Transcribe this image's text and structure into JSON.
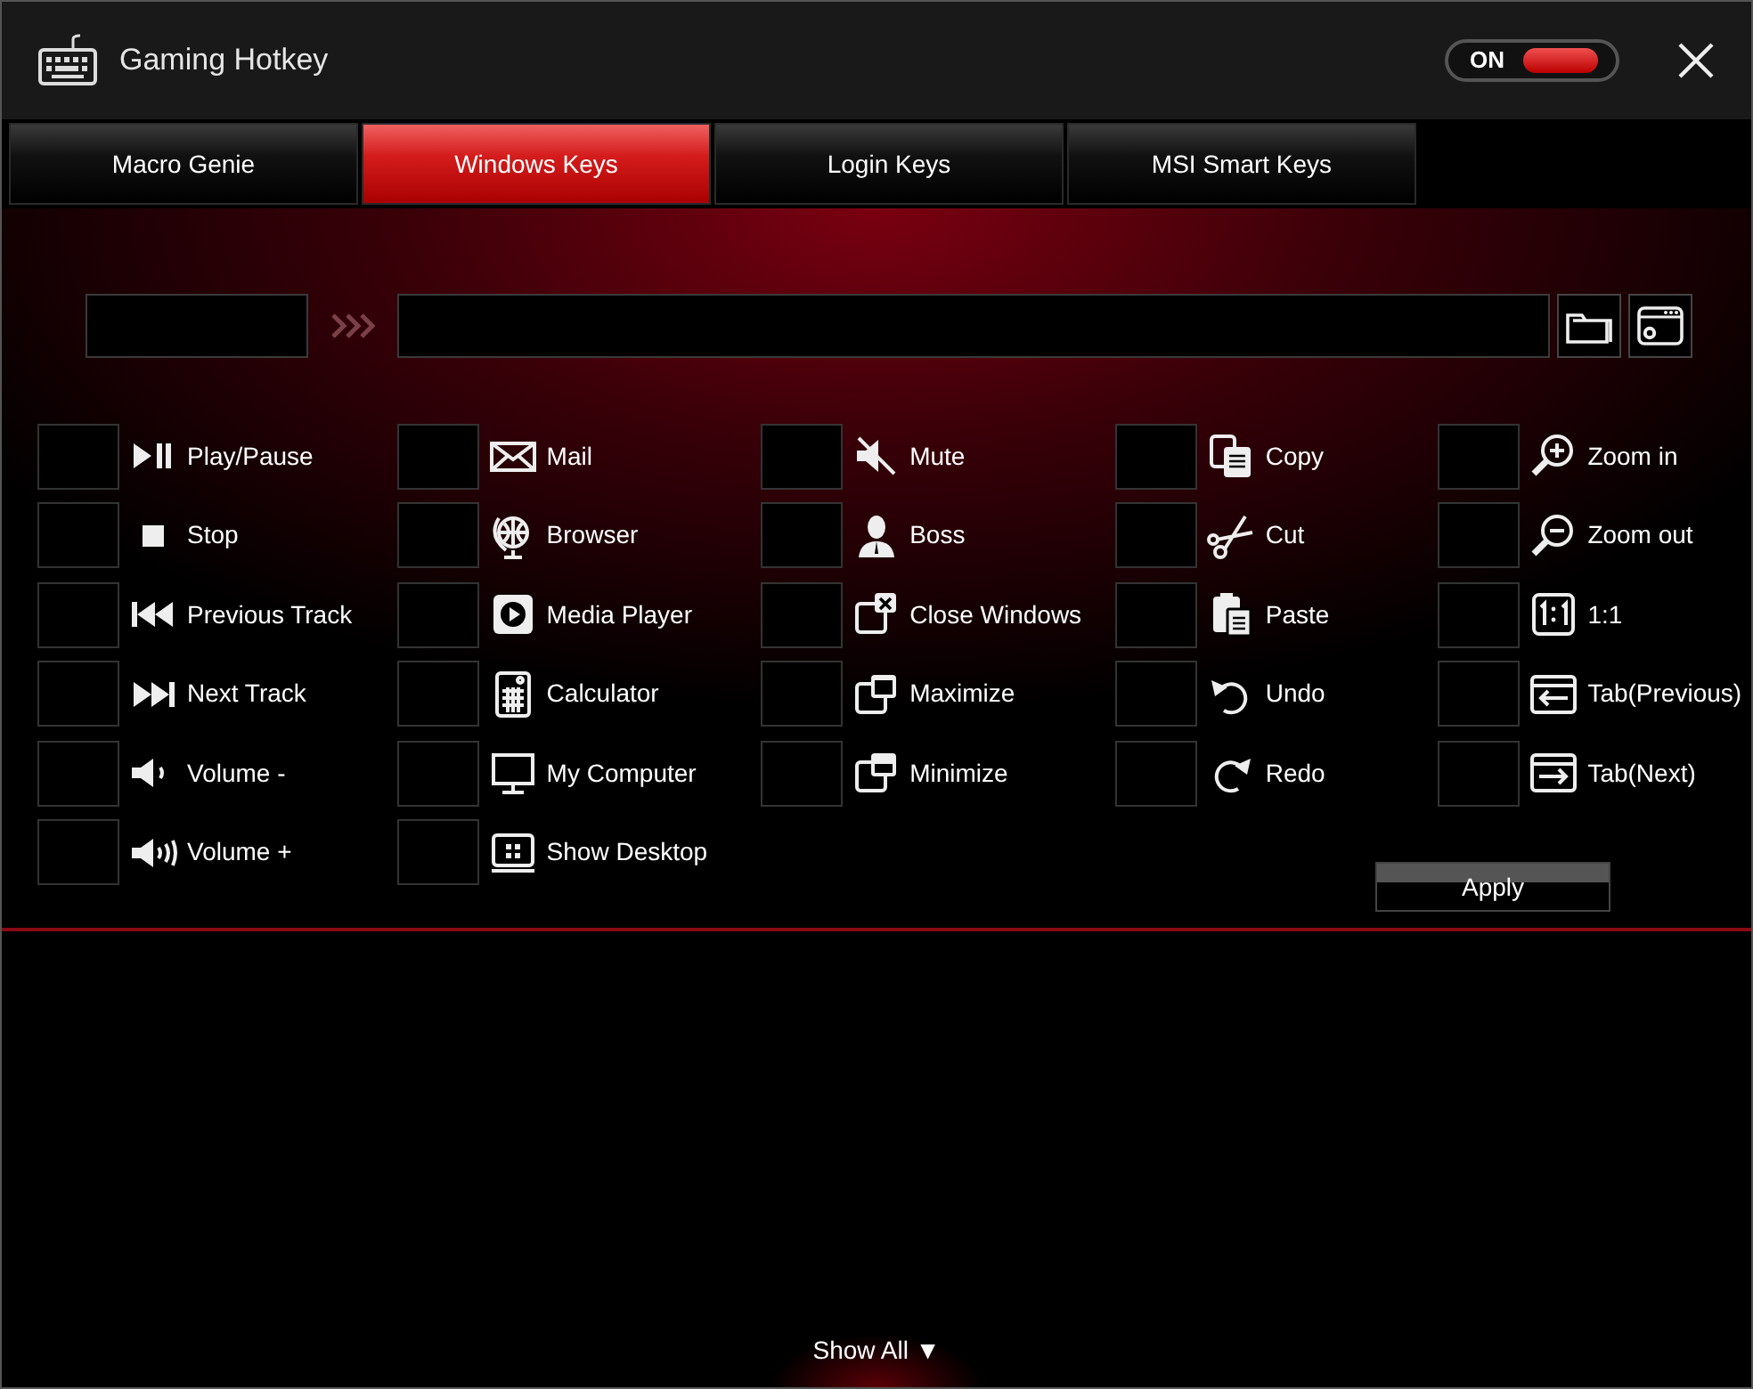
{
  "window": {
    "title": "Gaming Hotkey"
  },
  "power_toggle": {
    "label": "ON",
    "on": true
  },
  "tabs": [
    {
      "label": "Macro Genie",
      "selected": false
    },
    {
      "label": "Windows Keys",
      "selected": true
    },
    {
      "label": "Login Keys",
      "selected": false
    },
    {
      "label": "MSI Smart Keys",
      "selected": false
    }
  ],
  "key_columns": [
    [
      {
        "label": "Play/Pause"
      },
      {
        "label": "Stop"
      },
      {
        "label": "Previous Track"
      },
      {
        "label": "Next Track"
      },
      {
        "label": "Volume -"
      },
      {
        "label": "Volume +"
      }
    ],
    [
      {
        "label": "Mail"
      },
      {
        "label": "Browser"
      },
      {
        "label": "Media Player"
      },
      {
        "label": "Calculator"
      },
      {
        "label": "My Computer"
      },
      {
        "label": "Show Desktop"
      }
    ],
    [
      {
        "label": "Mute"
      },
      {
        "label": "Boss"
      },
      {
        "label": "Close Windows"
      },
      {
        "label": "Maximize"
      },
      {
        "label": "Minimize"
      }
    ],
    [
      {
        "label": "Copy"
      },
      {
        "label": "Cut"
      },
      {
        "label": "Paste"
      },
      {
        "label": "Undo"
      },
      {
        "label": "Redo"
      }
    ],
    [
      {
        "label": "Zoom in"
      },
      {
        "label": "Zoom out"
      },
      {
        "label": "1:1"
      },
      {
        "label": "Tab(Previous)"
      },
      {
        "label": "Tab(Next)"
      }
    ]
  ],
  "apply_button": "Apply",
  "show_all": "Show All ▼"
}
